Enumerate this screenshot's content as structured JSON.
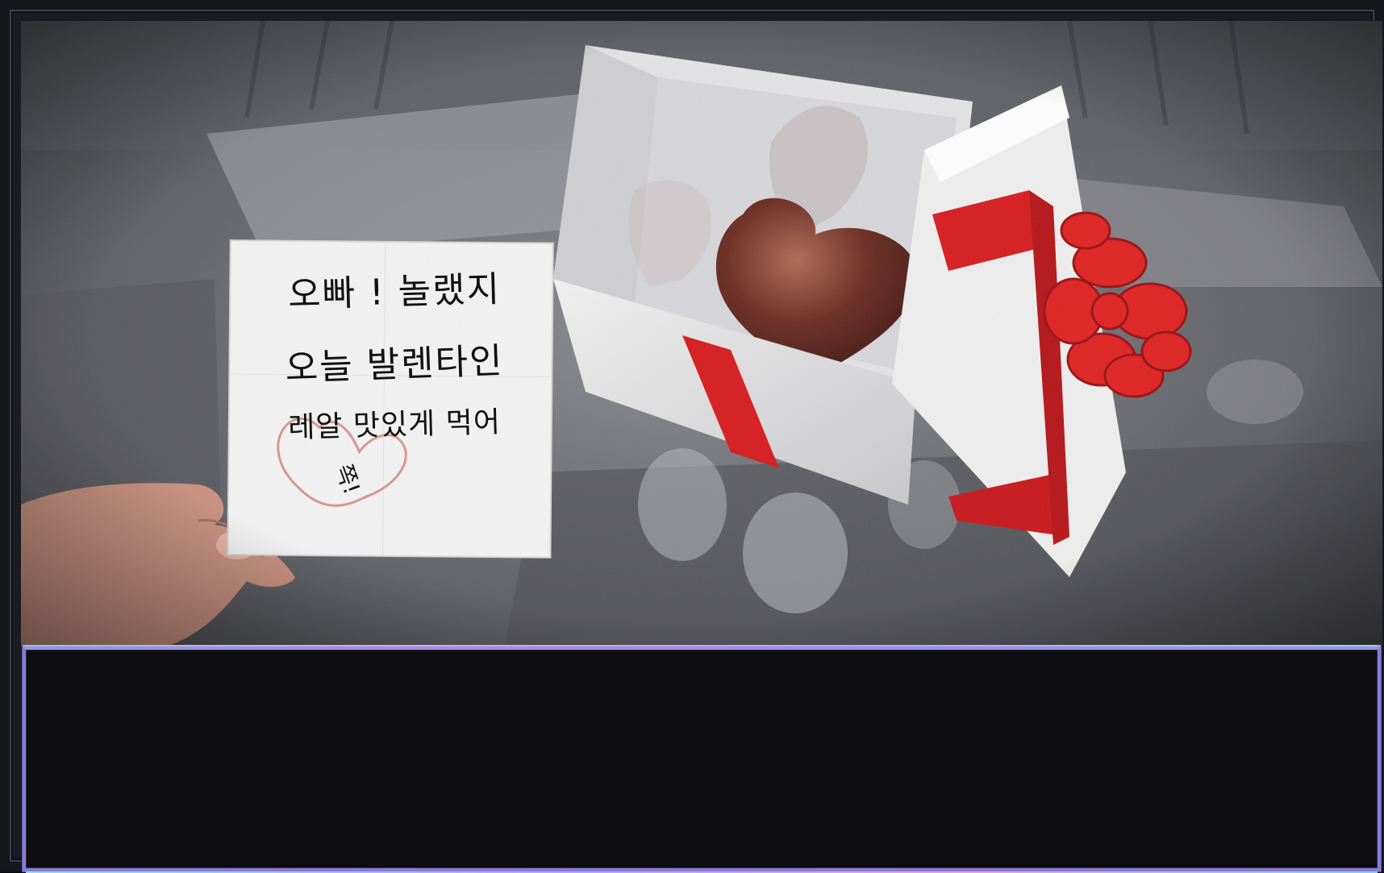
{
  "note": {
    "line1": "오빠 ! 놀랬지",
    "line2": "오늘 발렌타인",
    "line3": "레알 맛있게 먹어",
    "kiss": "쪽!"
  },
  "dialogue": {
    "text": ""
  },
  "colors": {
    "ribbon": "#d7191c",
    "chocolate": "#6b2a20",
    "dialogue_bg": "#0e0e10",
    "dialogue_border": "#8b7bd8"
  }
}
